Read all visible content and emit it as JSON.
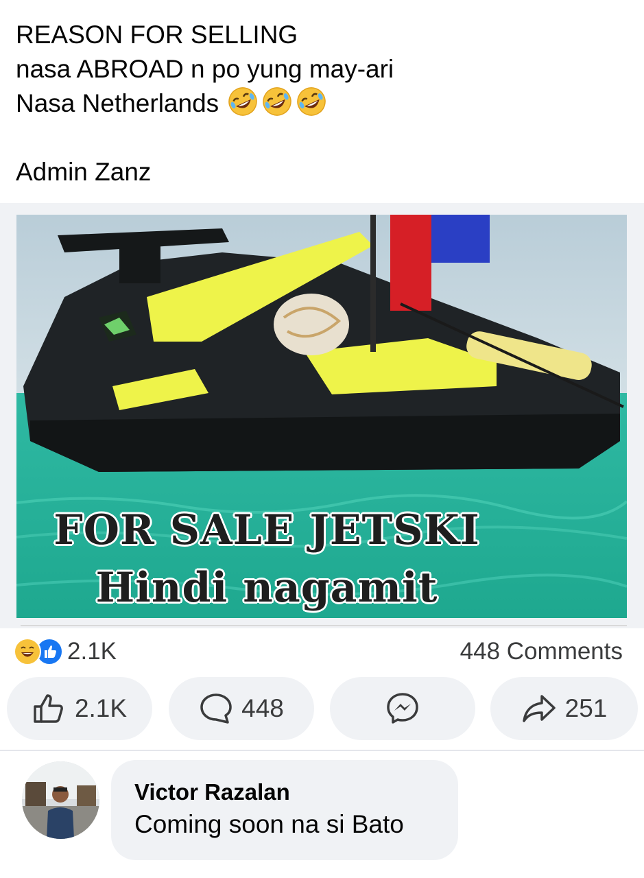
{
  "post": {
    "caption_lines": [
      "REASON FOR SELLING",
      "nasa ABROAD n po yung may-ari",
      "Nasa Netherlands"
    ],
    "caption_emojis": [
      "rolling-on-floor-laughing-emoji",
      "rolling-on-floor-laughing-emoji",
      "rolling-on-floor-laughing-emoji"
    ],
    "signature": "Admin Zanz",
    "image": {
      "overlay_line_1": "FOR SALE JETSKI",
      "overlay_line_2": "Hindi nagamit"
    }
  },
  "stats": {
    "reaction_icons": [
      "haha-reaction-icon",
      "like-reaction-icon"
    ],
    "reaction_count": "2.1K",
    "comments_label": "448 Comments"
  },
  "actions": {
    "like": "2.1K",
    "comment": "448",
    "share": "251"
  },
  "comment": {
    "author": "Victor Razalan",
    "text": "Coming soon na si Bato"
  },
  "colors": {
    "accent": "#1877f2",
    "pill_bg": "#f0f2f5",
    "secondary_text": "#3a3b3c",
    "water": "#22b59a",
    "jetski_yellow": "#eef34a"
  }
}
